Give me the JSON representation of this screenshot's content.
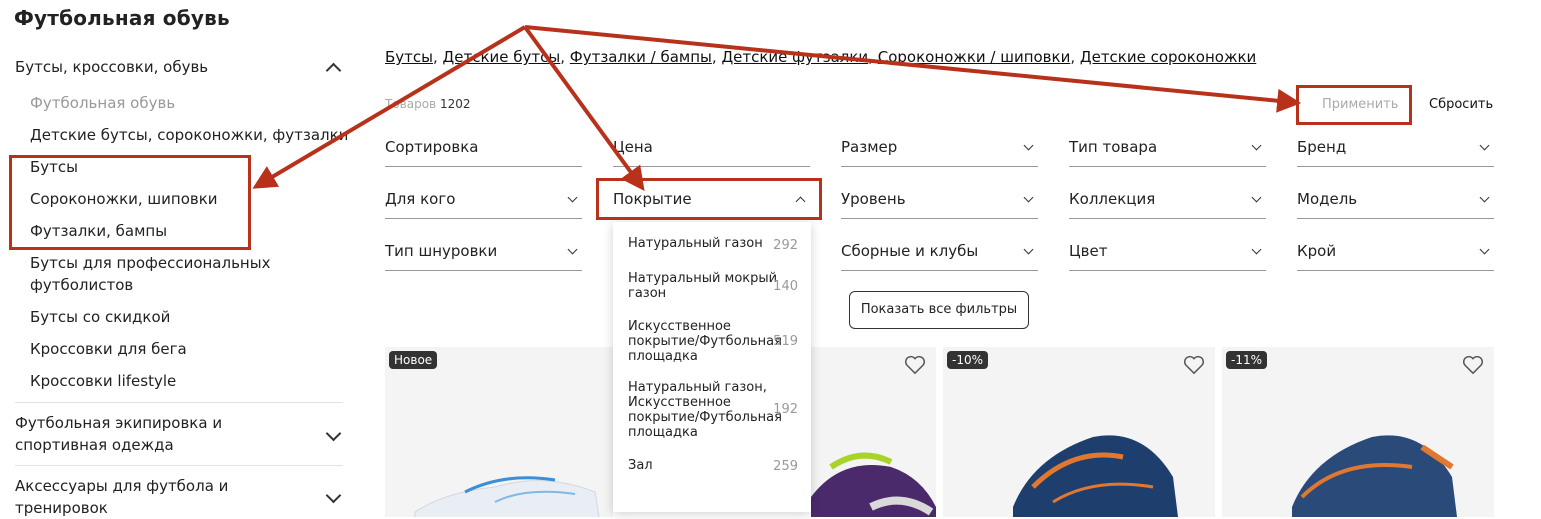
{
  "page_title": "Футбольная обувь",
  "sidebar": {
    "section1": {
      "label": "Бутсы, кроссовки, обувь"
    },
    "items": [
      {
        "label": "Футбольная обувь",
        "active": true
      },
      {
        "label": "Детские бутсы, сороконожки, футзалки"
      },
      {
        "label": "Бутсы"
      },
      {
        "label": "Сороконожки, шиповки"
      },
      {
        "label": "Футзалки, бампы"
      },
      {
        "label": "Бутсы для профессиональных"
      },
      {
        "label": "футболистов"
      },
      {
        "label": "Бутсы со скидкой"
      },
      {
        "label": "Кроссовки для бега"
      },
      {
        "label": "Кроссовки lifestyle"
      }
    ],
    "section2": {
      "label1": "Футбольная экипировка и",
      "label2": "спортивная одежда"
    },
    "section3": {
      "label1": "Аксессуары для футбола и",
      "label2": "тренировок"
    }
  },
  "breadcrumbs": [
    {
      "label": "Бутсы",
      "sep": ", "
    },
    {
      "label": "Детские бутсы",
      "sep": ", "
    },
    {
      "label": "Футзалки / бампы",
      "sep": ", "
    },
    {
      "label": "Детские футзалки",
      "sep": ", "
    },
    {
      "label": "Сороконожки / шиповки",
      "sep": ", "
    },
    {
      "label": "Детские сороконожки",
      "sep": ""
    }
  ],
  "results": {
    "label": "Товаров",
    "count": "1202"
  },
  "actions": {
    "apply": "Применить",
    "reset": "Сбросить"
  },
  "filters": {
    "row1": [
      "Сортировка",
      "Цена",
      "Размер",
      "Тип товара",
      "Бренд"
    ],
    "row2": [
      "Для кого",
      "Покрытие",
      "Уровень",
      "Коллекция",
      "Модель"
    ],
    "row3": [
      "Тип шнуровки",
      "",
      "Сборные и клубы",
      "Цвет",
      "Крой"
    ]
  },
  "coverage_dropdown": [
    {
      "label": "Натуральный газон",
      "count": "292"
    },
    {
      "label": "Натуральный мокрый газон",
      "count": "140"
    },
    {
      "label": "Искусственное покрытие/Футбольная площадка",
      "count": "519"
    },
    {
      "label": "Натуральный газон, Искусственное покрытие/Футбольная площадка",
      "count": "192"
    },
    {
      "label": "Зал",
      "count": "259"
    }
  ],
  "show_all_filters": "Показать все фильтры",
  "products": [
    {
      "badge": "Новое"
    },
    {
      "badge": ""
    },
    {
      "badge": "-10%"
    },
    {
      "badge": "-11%"
    }
  ],
  "colors": {
    "annotation_red": "#b8321b"
  }
}
